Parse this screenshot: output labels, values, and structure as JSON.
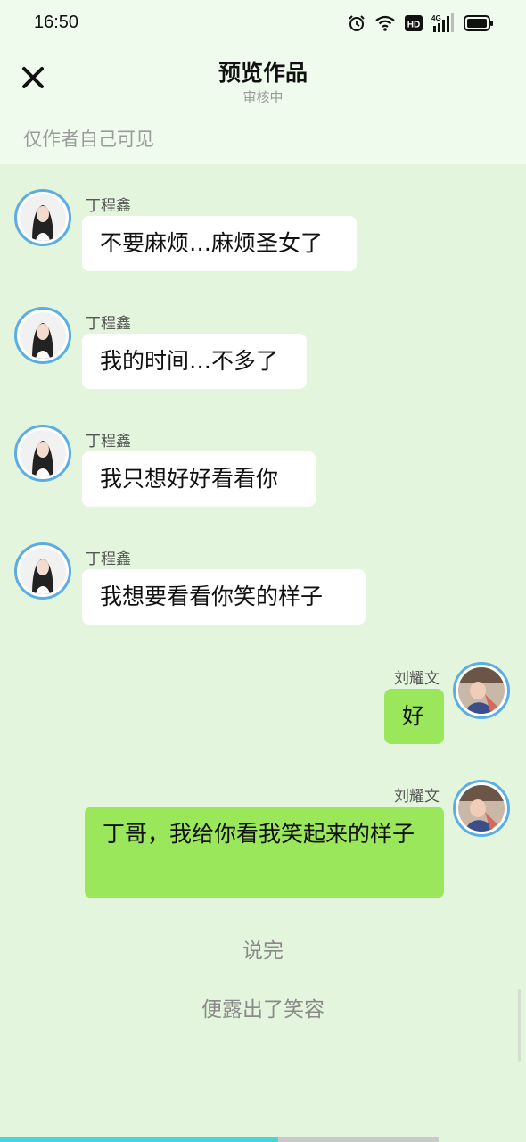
{
  "status_bar": {
    "time": "16:50",
    "icons": [
      "alarm-icon",
      "wifi-icon",
      "hd-icon",
      "4g-signal-icon",
      "battery-icon"
    ],
    "hd_label": "HD",
    "network_label": "4G"
  },
  "header": {
    "close_icon": "close-icon",
    "title": "预览作品",
    "subtitle": "审核中"
  },
  "visibility_note": "仅作者自己可见",
  "messages": [
    {
      "side": "left",
      "sender": "丁程鑫",
      "text": "不要麻烦…麻烦圣女了"
    },
    {
      "side": "left",
      "sender": "丁程鑫",
      "text": "我的时间…不多了"
    },
    {
      "side": "left",
      "sender": "丁程鑫",
      "text": "我只想好好看看你"
    },
    {
      "side": "left",
      "sender": "丁程鑫",
      "text": "我想要看看你笑的样子"
    },
    {
      "side": "right",
      "sender": "刘耀文",
      "text": "好"
    },
    {
      "side": "right",
      "sender": "刘耀文",
      "text": "丁哥，我给你看我笑起来的样子"
    }
  ],
  "narrations": [
    "说完",
    "便露出了笑容"
  ],
  "progress": {
    "fraction": 0.635
  },
  "colors": {
    "left_bubble": "#ffffff",
    "right_bubble": "#9be75c",
    "chat_background": "#e4f5dd",
    "header_background": "#eefbed",
    "avatar_ring": "#5aaee4",
    "progress": "#49d4d8"
  }
}
